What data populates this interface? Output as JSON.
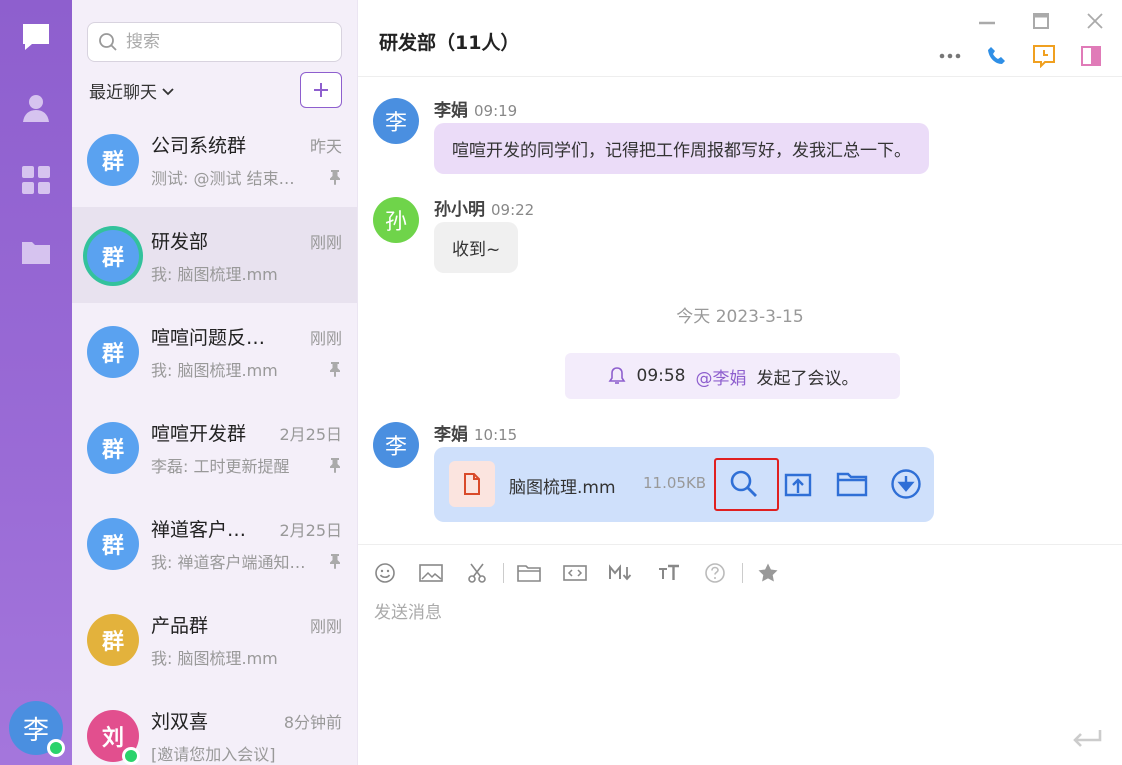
{
  "user": {
    "avatar_char": "李",
    "status_color": "#2bd36b"
  },
  "rail": {
    "items": [
      "chat-icon",
      "contacts-icon",
      "apps-icon",
      "folder-icon"
    ]
  },
  "search": {
    "placeholder": "搜索"
  },
  "list": {
    "filter_label": "最近聊天",
    "add_label": "+"
  },
  "conversations": [
    {
      "avatar": "群",
      "color": "#5aa2f0",
      "name": "公司系统群",
      "time": "昨天",
      "preview": "测试: @测试 结束…",
      "pinned": true
    },
    {
      "avatar": "群",
      "color": "#5aa2f0",
      "name": "研发部",
      "time": "刚刚",
      "preview": "我: 脑图梳理.mm",
      "pinned": false,
      "active": true
    },
    {
      "avatar": "群",
      "color": "#5aa2f0",
      "name": "喧喧问题反馈群",
      "time": "刚刚",
      "preview": "我: 脑图梳理.mm",
      "pinned": true
    },
    {
      "avatar": "群",
      "color": "#5aa2f0",
      "name": "喧喧开发群",
      "time": "2月25日",
      "preview": "李磊: 工时更新提醒",
      "pinned": true
    },
    {
      "avatar": "群",
      "color": "#5aa2f0",
      "name": "禅道客户…",
      "time": "2月25日",
      "preview": "我: 禅道客户端通知…",
      "pinned": true
    },
    {
      "avatar": "群",
      "color": "#e3b23c",
      "name": "产品群",
      "time": "刚刚",
      "preview": "我: 脑图梳理.mm",
      "pinned": false
    },
    {
      "avatar": "刘",
      "color": "#e24f8e",
      "name": "刘双喜",
      "time": "8分钟前",
      "preview": "[邀请您加入会议]",
      "pinned": false,
      "online": true
    }
  ],
  "chat": {
    "title": "研发部（11人）",
    "messages": [
      {
        "avatar": "李",
        "avatar_color": "#4a8fe0",
        "sender": "李娟",
        "time": "09:19",
        "text": "喧喧开发的同学们，记得把工作周报都写好，发我汇总一下。"
      },
      {
        "avatar": "孙",
        "avatar_color": "#6fd44a",
        "sender": "孙小明",
        "time": "09:22",
        "text": "收到~"
      }
    ],
    "date_separator": "今天 2023-3-15",
    "system_note": {
      "time": "09:58",
      "mention": "@李娟",
      "text": "发起了会议。"
    },
    "file_message": {
      "avatar": "李",
      "avatar_color": "#4a8fe0",
      "sender": "李娟",
      "time": "10:15",
      "file_name": "脑图梳理.mm",
      "file_size": "11.05KB"
    },
    "composer_placeholder": "发送消息"
  },
  "colors": {
    "accent": "#8e5fce",
    "file_card": "#cfe0fb",
    "bubble_mine": "#ebdcf8",
    "bubble_other": "#f0f0f0",
    "highlight": "#e02020"
  }
}
